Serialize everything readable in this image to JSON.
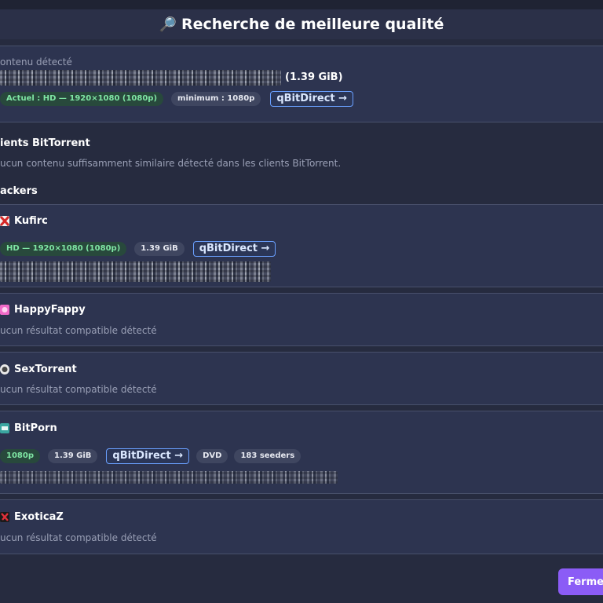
{
  "dialog": {
    "icon": "🔎",
    "title": "Recherche de meilleure qualité"
  },
  "detected": {
    "label": "ontenu détecté",
    "size": "(1.39 GiB)",
    "current_badge": "Actuel : HD — 1920×1080 (1080p)",
    "minimum_badge": "minimum : 1080p",
    "qbit_label": "qBitDirect →"
  },
  "clients": {
    "title": "ients BitTorrent",
    "message": "ucun contenu suffisamment similaire détecté dans les clients BitTorrent."
  },
  "trackers": {
    "title": "ackers",
    "items": [
      {
        "name": "Kufirc",
        "icon": "kufirc-icon",
        "badges": [
          "HD — 1920×1080 (1080p)",
          "1.39 GiB"
        ],
        "qbit": "qBitDirect →"
      },
      {
        "name": "HappyFappy",
        "icon": "happyfappy-icon",
        "message": "ucun résultat compatible détecté"
      },
      {
        "name": "SexTorrent",
        "icon": "sextorrent-icon",
        "message": "ucun résultat compatible détecté"
      },
      {
        "name": "BitPorn",
        "icon": "bitporn-icon",
        "badges": [
          "1080p",
          "1.39 GiB"
        ],
        "qbit": "qBitDirect →",
        "extra_badges": [
          "DVD",
          "183 seeders"
        ]
      },
      {
        "name": "ExoticaZ",
        "icon": "exoticaz-icon",
        "message": "ucun résultat compatible détecté"
      }
    ]
  },
  "footer": {
    "close_label": "Fermer"
  },
  "colors": {
    "background": "#262b3f",
    "panel": "#2d3450",
    "accent": "#8b5cf6",
    "qbit_border": "#6aa0ff",
    "green_badge_text": "#7fe6a4"
  }
}
